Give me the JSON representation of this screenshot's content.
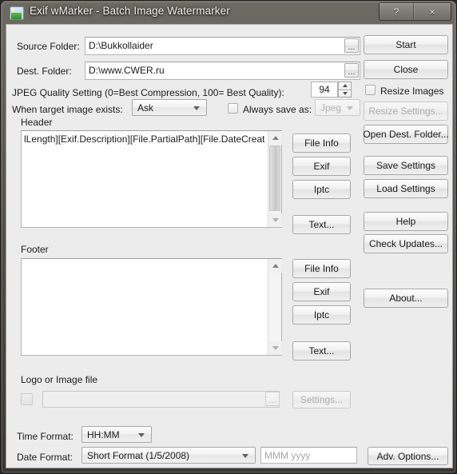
{
  "window": {
    "title": "Exif wMarker - Batch Image Watermarker",
    "icon": "image-app-icon",
    "help_button": "?",
    "close_button": "×"
  },
  "form": {
    "source_folder_label": "Source Folder:",
    "source_folder_value": "D:\\Bukkollaider",
    "source_browse_label": "...",
    "dest_folder_label": "Dest. Folder:",
    "dest_folder_value": "D:\\www.CWER.ru",
    "dest_browse_label": "...",
    "jpeg_quality_label": "JPEG Quality Setting (0=Best Compression, 100= Best Quality):",
    "jpeg_quality_value": "94",
    "target_exists_label": "When target image exists:",
    "target_exists_value": "Ask",
    "always_save_as_label": "Always save as:",
    "always_save_as_checked": false,
    "save_format_value": "Jpeg"
  },
  "header_section": {
    "label": "Header",
    "text": "lLength][Exif.Description][File.PartialPath][File.DateCreation]",
    "buttons": {
      "file_info": "File Info",
      "exif": "Exif",
      "iptc": "Iptc",
      "text": "Text..."
    }
  },
  "footer_section": {
    "label": "Footer",
    "text": "",
    "buttons": {
      "file_info": "File Info",
      "exif": "Exif",
      "iptc": "Iptc",
      "text": "Text..."
    }
  },
  "logo_section": {
    "label": "Logo or Image file",
    "enabled": false,
    "path_value": "",
    "browse_label": "...",
    "settings_label": "Settings..."
  },
  "formats": {
    "time_format_label": "Time Format:",
    "time_format_value": "HH:MM",
    "date_format_label": "Date Format:",
    "date_format_value": "Short Format (1/5/2008)",
    "custom_date_placeholder": "MMM yyyy",
    "adv_options_label": "Adv. Options..."
  },
  "side_panel": {
    "start": "Start",
    "close": "Close",
    "resize_images_label": "Resize Images",
    "resize_images_checked": false,
    "resize_settings": "Resize Settings...",
    "open_dest_folder": "Open Dest. Folder...",
    "save_settings": "Save Settings",
    "load_settings": "Load Settings",
    "help": "Help",
    "check_updates": "Check Updates...",
    "about": "About..."
  }
}
